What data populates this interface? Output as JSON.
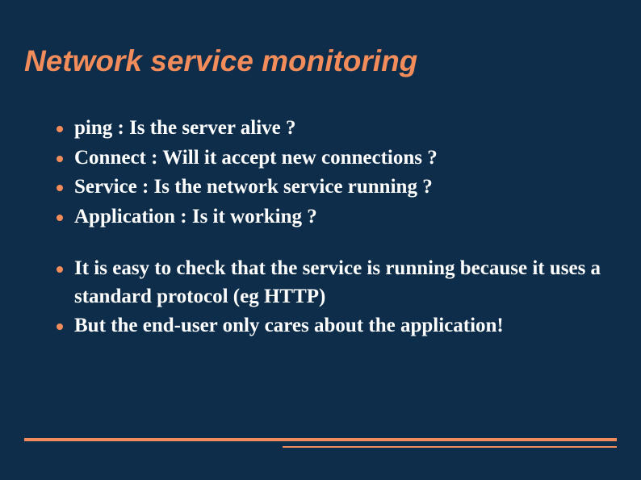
{
  "title": "Network service monitoring",
  "group1": {
    "b0": "ping : Is the server alive ?",
    "b1": "Connect : Will it accept new connections ?",
    "b2": "Service : Is the network service running ?",
    "b3": "Application : Is it working ?"
  },
  "group2": {
    "b0": "It is easy to check that the service is running because it uses a standard protocol (eg HTTP)",
    "b1": "But the end-user only cares about the application!"
  },
  "colors": {
    "background": "#0d2d4a",
    "accent": "#f28c5a",
    "text": "#ffffff"
  }
}
